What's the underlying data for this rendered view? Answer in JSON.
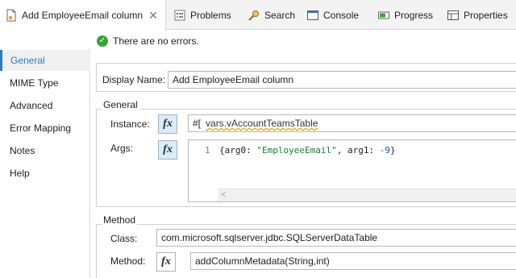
{
  "tabs": [
    {
      "label": "Add EmployeeEmail column",
      "icon": "document-icon",
      "active": true
    },
    {
      "label": "Problems",
      "icon": "problems-icon"
    },
    {
      "label": "Search",
      "icon": "search-icon"
    },
    {
      "label": "Console",
      "icon": "console-icon"
    },
    {
      "label": "Progress",
      "icon": "progress-icon"
    },
    {
      "label": "Properties",
      "icon": "properties-icon"
    }
  ],
  "status": {
    "text": "There are no errors."
  },
  "nav": {
    "items": [
      "General",
      "MIME Type",
      "Advanced",
      "Error Mapping",
      "Notes",
      "Help"
    ],
    "active": "General"
  },
  "form": {
    "display_name_label": "Display Name:",
    "display_name_value": "Add EmployeeEmail column",
    "general_group": "General",
    "instance_label": "Instance:",
    "instance_prefix": "#[",
    "instance_value": "vars.vAccountTeamsTable",
    "args_label": "Args:",
    "args_line_number": "1",
    "args_code": {
      "open": "{arg0: ",
      "str": "\"EmployeeEmail\"",
      "mid": ", arg1: ",
      "num": "-9",
      "close": "}"
    },
    "method_group": "Method",
    "class_label": "Class:",
    "class_value": "com.microsoft.sqlserver.jdbc.SQLServerDataTable",
    "method_label": "Method:",
    "method_value": "addColumnMetadata(String,int)",
    "fx_label": "fx"
  },
  "colors": {
    "accent": "#2a7dc0",
    "ok": "#3aa335"
  }
}
